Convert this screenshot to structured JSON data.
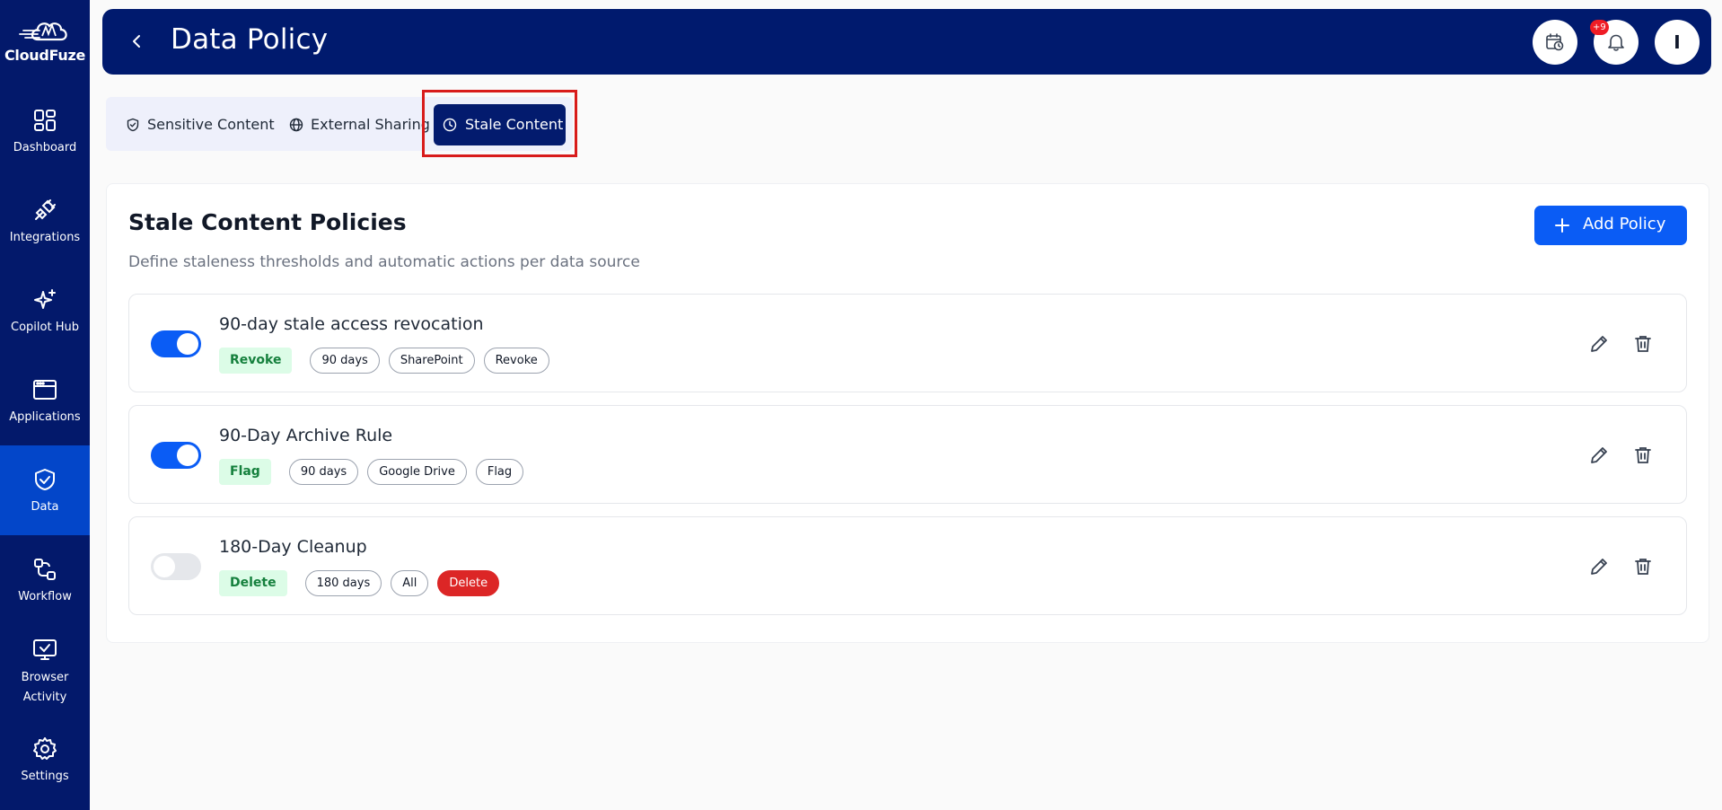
{
  "brand": {
    "name": "CloudFuze"
  },
  "sidebar": {
    "items": [
      {
        "label": "Dashboard",
        "icon": "dashboard-icon",
        "active": false
      },
      {
        "label": "Integrations",
        "icon": "plug-icon",
        "active": false
      },
      {
        "label": "Copilot Hub",
        "icon": "sparkle-icon",
        "active": false
      },
      {
        "label": "Applications",
        "icon": "browser-window-icon",
        "active": false
      },
      {
        "label": "Data",
        "icon": "shield-check-icon",
        "active": true
      },
      {
        "label": "Workflow",
        "icon": "workflow-icon",
        "active": false
      },
      {
        "label": "Browser Activity",
        "icon": "monitor-check-icon",
        "active": false
      },
      {
        "label": "Settings",
        "icon": "gear-icon",
        "active": false
      }
    ]
  },
  "header": {
    "title": "Data Policy",
    "notification_count": "+9",
    "avatar_initial": "I"
  },
  "tabs": [
    {
      "label": "Sensitive Content",
      "icon": "shield-check-icon",
      "active": false
    },
    {
      "label": "External Sharing",
      "icon": "globe-icon",
      "active": false
    },
    {
      "label": "Stale Content",
      "icon": "clock-icon",
      "active": true
    }
  ],
  "card": {
    "title": "Stale Content Policies",
    "subtitle": "Define staleness thresholds and automatic actions per data source",
    "add_button": "Add Policy"
  },
  "policies": [
    {
      "name": "90-day stale access revocation",
      "enabled": true,
      "action": "Revoke",
      "threshold": "90 days",
      "source": "SharePoint",
      "action_chip": "Revoke",
      "action_chip_danger": false
    },
    {
      "name": "90-Day Archive Rule",
      "enabled": true,
      "action": "Flag",
      "threshold": "90 days",
      "source": "Google Drive",
      "action_chip": "Flag",
      "action_chip_danger": false
    },
    {
      "name": "180-Day Cleanup",
      "enabled": false,
      "action": "Delete",
      "threshold": "180 days",
      "source": "All",
      "action_chip": "Delete",
      "action_chip_danger": true
    }
  ],
  "colors": {
    "sidebar": "#03196b",
    "sidebar_active": "#0346c9",
    "header": "#001a6e",
    "primary": "#0a5cf5",
    "danger": "#dc2626",
    "action_chip_bg": "#dcfce7",
    "action_chip_text": "#15803d"
  }
}
